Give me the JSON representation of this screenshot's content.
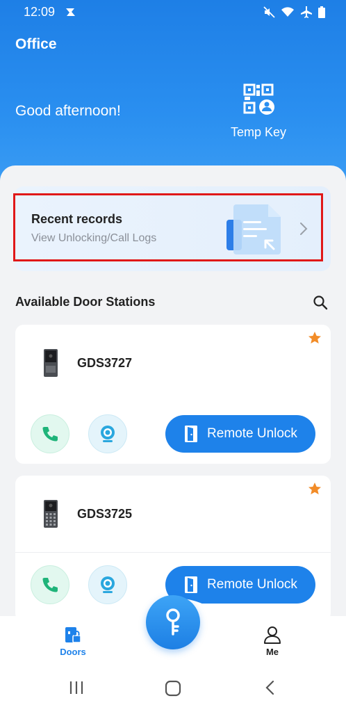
{
  "status_bar": {
    "time": "12:09"
  },
  "header": {
    "site_name": "Office",
    "greeting": "Good afternoon!",
    "temp_key_label": "Temp Key"
  },
  "recent_records": {
    "title": "Recent records",
    "subtitle": "View Unlocking/Call Logs"
  },
  "section": {
    "title": "Available Door Stations"
  },
  "door_stations": [
    {
      "name": "GDS3727",
      "favorite": true,
      "unlock_label": "Remote Unlock"
    },
    {
      "name": "GDS3725",
      "favorite": true,
      "unlock_label": "Remote Unlock"
    }
  ],
  "tabs": [
    {
      "label": "Doors",
      "active": true,
      "icon": "door-lock-icon"
    },
    {
      "label": "Me",
      "active": false,
      "icon": "person-icon"
    }
  ],
  "colors": {
    "accent": "#1e82ea",
    "favorite": "#f28c28",
    "call": "#1fb47a",
    "highlight": "#e01818"
  }
}
